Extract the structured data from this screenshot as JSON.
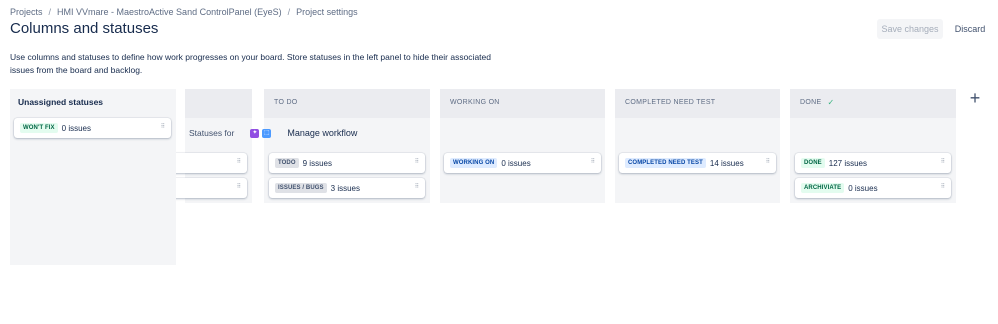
{
  "breadcrumbs": {
    "items": [
      "Projects",
      "HMI VVmare - MaestroActive Sand ControlPanel (EyeS)",
      "Project settings"
    ],
    "separator": "/"
  },
  "page": {
    "title": "Columns and statuses",
    "description": "Use columns and statuses to define how work progresses on your board. Store statuses in the left panel to hide their associated issues from the board and backlog."
  },
  "actions": {
    "save_label": "Save changes",
    "discard_label": "Discard",
    "add_column_glyph": "+"
  },
  "workflow": {
    "statuses_for_label": "Statuses for",
    "manage_label": "Manage workflow",
    "icons": [
      "purple-project-icon",
      "blue-project-icon"
    ]
  },
  "unassigned": {
    "title": "Unassigned statuses",
    "cards": [
      {
        "status": "WON'T FIX",
        "count": "0 issues",
        "color": "green"
      }
    ]
  },
  "columns": [
    {
      "name": "",
      "cards": []
    },
    {
      "name": "TO DO",
      "cards": [
        {
          "status": "TODO",
          "count": "9 issues",
          "color": "grey"
        },
        {
          "status": "ISSUES / BUGS",
          "count": "3 issues",
          "color": "grey"
        }
      ]
    },
    {
      "name": "WORKING ON",
      "cards": [
        {
          "status": "WORKING ON",
          "count": "0 issues",
          "color": "blue"
        }
      ]
    },
    {
      "name": "COMPLETED NEED TEST",
      "cards": [
        {
          "status": "COMPLETED NEED TEST",
          "count": "14 issues",
          "color": "blue"
        }
      ]
    },
    {
      "name": "DONE",
      "done_check": "✓",
      "cards": [
        {
          "status": "DONE",
          "count": "127 issues",
          "color": "green"
        },
        {
          "status": "ARCHIVIATE",
          "count": "0 issues",
          "color": "green"
        }
      ]
    }
  ],
  "colors": {
    "grey_lozenge": "#dfe1e6",
    "blue_lozenge": "#deebff",
    "green_lozenge": "#e3fcef",
    "column_bg": "#f4f5f7",
    "header_bg": "#ebecf0"
  }
}
